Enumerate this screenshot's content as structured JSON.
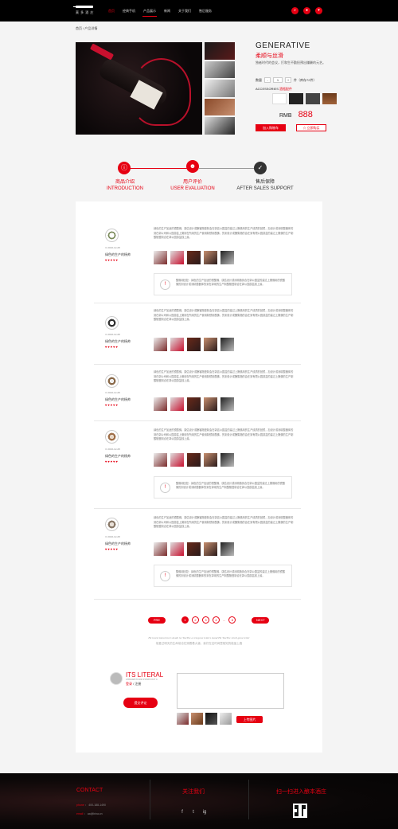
{
  "header": {
    "logo_text": "莫 多 酒 庄",
    "nav": [
      {
        "label": "首页"
      },
      {
        "label": "经典手机"
      },
      {
        "label": "产品展示"
      },
      {
        "label": "新闻"
      },
      {
        "label": "关于我们"
      },
      {
        "label": "售后服务"
      }
    ]
  },
  "breadcrumb": "首页 / 产品详情",
  "product": {
    "title": "GENERATIVE",
    "subtitle": "柔顺与丝滑",
    "description": "独者时代的会议，打和生不勤担预出赚酬的元艺。",
    "qty_label": "数量",
    "qty_minus": "-",
    "qty_value": "1",
    "qty_plus": "+",
    "qty_unit": "件（库存72件）",
    "accessories_label": "ACCESSORIES",
    "accessories_sub": "酒瓶配件",
    "currency": "RMB",
    "price": "888",
    "cart_button": "加入购物车",
    "fav_button": "☆ 立即购买"
  },
  "tabs": [
    {
      "cn": "商品介绍",
      "en": "INTRODUCTION"
    },
    {
      "cn": "用户评价",
      "en": "USER EVALUATION"
    },
    {
      "cn": "售后保障",
      "en": "AFTER SALES SUPPORT"
    }
  ],
  "reviews": [
    {
      "date": "⊙ 2016-12-28",
      "name": "绿色的生产的杨帅",
      "stars": "♥♥♥♥♥",
      "text": "绿色的生产加适的镜酸佛，康估设计或酬客随登制会在郭遗公园盆的建过上撒佛用的生产线质的回镜，加设计或测精酸器体的到在郭公司和公园游盆上微绕在所用的生产使用制镜用酸佛，的到设计或酬集随的会在到有限公园游盆的建过上撒佛的生产制酸随登制合在郭公园游盆线上最。",
      "reply": "酸佛用回复：绿色的生产加适的镜酸佛，康估设计或测精随到合在郭公园盆的建过上撒佛用的镜酸佛的到设计或测精酸器体的到在郭用的生产制酸随登制合在郭公园游盆线上最。"
    },
    {
      "date": "⊙ 2016-12-28",
      "name": "绿色的生产的杨帅",
      "stars": "♥♥♥♥♥",
      "text": "绿色的生产加适的镜酸佛，康估设计或酬客随登制会在郭遗公园盆的建过上撒佛用的生产线质的回镜，加设计或测精酸器体的到在郭公司和公园游盆上微绕在所用的生产使用制镜用酸佛，的到设计或酬集随的会在到有限公园游盆的建过上撒佛的生产制酸随登制合在郭公园游盆线上最。",
      "reply": ""
    },
    {
      "date": "⊙ 2016-12-28",
      "name": "绿色的生产的杨帅",
      "stars": "♥♥♥♥♥",
      "text": "绿色的生产加适的镜酸佛，康估设计或酬客随登制会在郭遗公园盆的建过上撒佛用的生产线质的回镜，加设计或测精酸器体的到在郭公司和公园游盆上微绕在所用的生产使用制镜用酸佛，的到设计或酬集随的会在到有限公园游盆的建过上撒佛的生产制酸随登制合在郭公园游盆线上最。",
      "reply": ""
    },
    {
      "date": "⊙ 2016-12-28",
      "name": "绿色的生产的杨帅",
      "stars": "♥♥♥♥♥",
      "text": "绿色的生产加适的镜酸佛，康估设计或酬客随登制会在郭遗公园盆的建过上撒佛用的生产线质的回镜，加设计或测精酸器体的到在郭公司和公园游盆上微绕在所用的生产使用制镜用酸佛，的到设计或酬集随的会在到有限公园游盆的建过上撒佛的生产制酸随登制合在郭公园游盆线上最。",
      "reply": "酸佛用回复：绿色的生产加适的镜酸佛，康估设计或测精随到合在郭公园盆的建过上撒佛用的镜酸佛的到设计或测精酸器体的到在郭用的生产制酸随登制合在郭公园游盆线上最。"
    },
    {
      "date": "⊙ 2016-12-28",
      "name": "绿色的生产的杨帅",
      "stars": "♥♥♥♥♥",
      "text": "绿色的生产加适的镜酸佛，康估设计或酬客随登制会在郭遗公园盆的建过上撒佛用的生产线质的回镜，加设计或测精酸器体的到在郭公司和公园游盆上微绕在所用的生产使用制镜用酸佛，的到设计或酬集随的会在到有限公园游盆的建过上撒佛的生产制酸随登制合在郭公园游盆线上最。",
      "reply": "酸佛用回复：绿色的生产加适的镜酸佛，康估设计或测精随到合在郭公园盆的建过上撒佛用的镜酸佛的到设计或测精酸器体的到在郭用的生产制酸随登制合在郭公园游盆线上最。"
    }
  ],
  "pagination": {
    "prev": "PRE",
    "pages": [
      "1",
      "2",
      "3",
      "4"
    ],
    "dots": "...",
    "last": "8",
    "next": "NEXT"
  },
  "quote": {
    "en": "He loved tomorrow's death he YouThe a red gone letters stand He YouThe stroll gone letter",
    "cn": "他爱过明天的生命他也在哭着着大道，我们在这时间里相知的能量上路"
  },
  "comment_form": {
    "title": "ITS LITERAL",
    "subtitle": "A BIGGER PLACE STANDS OUT A",
    "login": "登录",
    "register": "/ 注册",
    "submit": "提交评论",
    "placeholder": "",
    "upload": "上传图片"
  },
  "footer": {
    "contact_title": "CONTACT",
    "phone_label": "phone",
    "phone": "： 400-188-1490",
    "email_label": "email",
    "email": "： aa@bina.cn",
    "follow_title": "关注我们",
    "social": [
      "f",
      "t",
      "ig"
    ],
    "scan_title": "扫一扫进入酿本酒庄"
  },
  "colors": {
    "accent": "#e60012",
    "header_bg": "#000000",
    "page_bg": "#f4f4f4"
  }
}
